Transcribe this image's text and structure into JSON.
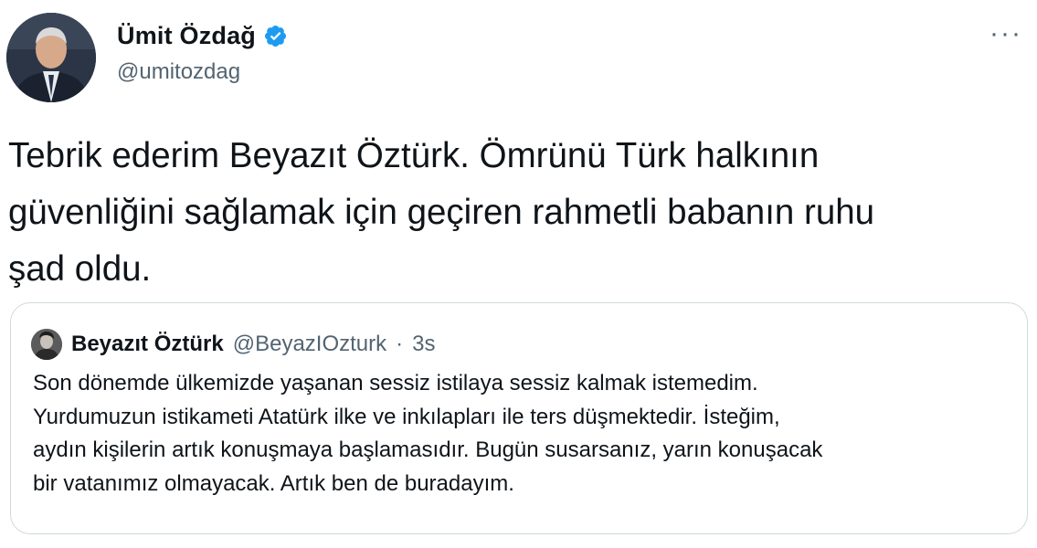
{
  "author": {
    "name": "Ümit Özdağ",
    "handle": "@umitozdag",
    "verified": true,
    "avatar_icon": "user-avatar"
  },
  "menu": {
    "more_label": "···",
    "more_icon": "more-options-icon"
  },
  "tweet": {
    "text": "Tebrik ederim Beyazıt Öztürk. Ömrünü Türk halkının\ngüvenliğini sağlamak için geçiren rahmetli babanın ruhu\nşad oldu."
  },
  "quote": {
    "author_name": "Beyazıt Öztürk",
    "author_handle": "@BeyazIOzturk",
    "separator": "·",
    "time": "3s",
    "text": "Son dönemde ülkemizde yaşanan sessiz istilaya sessiz kalmak istemedim.\nYurdumuzun istikameti Atatürk ilke ve inkılapları ile ters düşmektedir. İsteğim,\naydın kişilerin artık konuşmaya başlamasıdır. Bugün susarsanız, yarın konuşacak\nbir vatanımız olmayacak. Artık ben de buradayım."
  },
  "colors": {
    "verified_badge": "#1d9bf0",
    "secondary_text": "#536471",
    "border": "#cfd9de"
  }
}
